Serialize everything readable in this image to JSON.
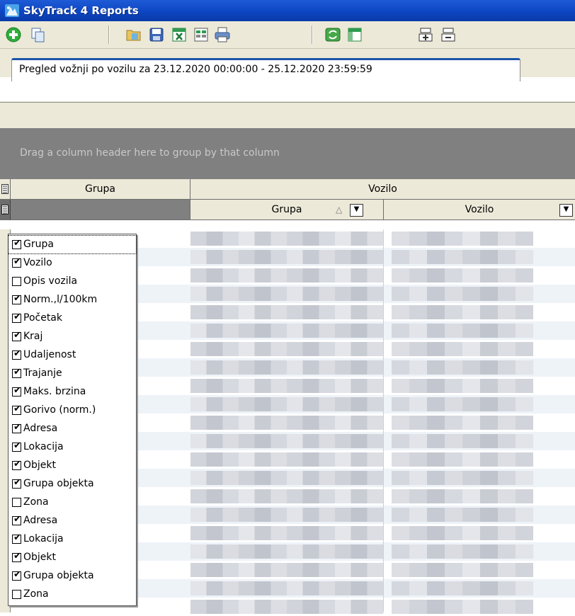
{
  "window": {
    "title": "SkyTrack 4 Reports"
  },
  "toolbar": {
    "icons": [
      "add-icon",
      "copy-icon",
      "open-folder-icon",
      "save-icon",
      "excel-icon",
      "export-icon",
      "print-icon",
      "refresh-icon",
      "window-icon",
      "expand-all-icon",
      "collapse-all-icon"
    ]
  },
  "tab": {
    "label": "Pregled vožnji po vozilu za 23.12.2020 00:00:00 - 25.12.2020 23:59:59"
  },
  "grid": {
    "group_hint": "Drag a column header here to group by that column",
    "band_headers": [
      "Grupa",
      "Vozilo"
    ],
    "column_headers": [
      "Grupa",
      "Vozilo"
    ]
  },
  "column_chooser": {
    "items": [
      {
        "label": "Grupa",
        "checked": true
      },
      {
        "label": "Vozilo",
        "checked": true
      },
      {
        "label": "Opis vozila",
        "checked": false
      },
      {
        "label": "Norm.,l/100km",
        "checked": true
      },
      {
        "label": "Početak",
        "checked": true
      },
      {
        "label": "Kraj",
        "checked": true
      },
      {
        "label": "Udaljenost",
        "checked": true
      },
      {
        "label": "Trajanje",
        "checked": true
      },
      {
        "label": "Maks. brzina",
        "checked": true
      },
      {
        "label": "Gorivo (norm.)",
        "checked": true
      },
      {
        "label": "Adresa",
        "checked": true
      },
      {
        "label": "Lokacija",
        "checked": true
      },
      {
        "label": "Objekt",
        "checked": true
      },
      {
        "label": "Grupa objekta",
        "checked": true
      },
      {
        "label": "Zona",
        "checked": false
      },
      {
        "label": "Adresa",
        "checked": true
      },
      {
        "label": "Lokacija",
        "checked": true
      },
      {
        "label": "Objekt",
        "checked": true
      },
      {
        "label": "Grupa objekta",
        "checked": true
      },
      {
        "label": "Zona",
        "checked": false
      }
    ]
  },
  "colors": {
    "title_bar": "#0d46c2",
    "chrome": "#ece9d8",
    "group_area": "#808080",
    "tab_accent": "#1b55a8"
  }
}
